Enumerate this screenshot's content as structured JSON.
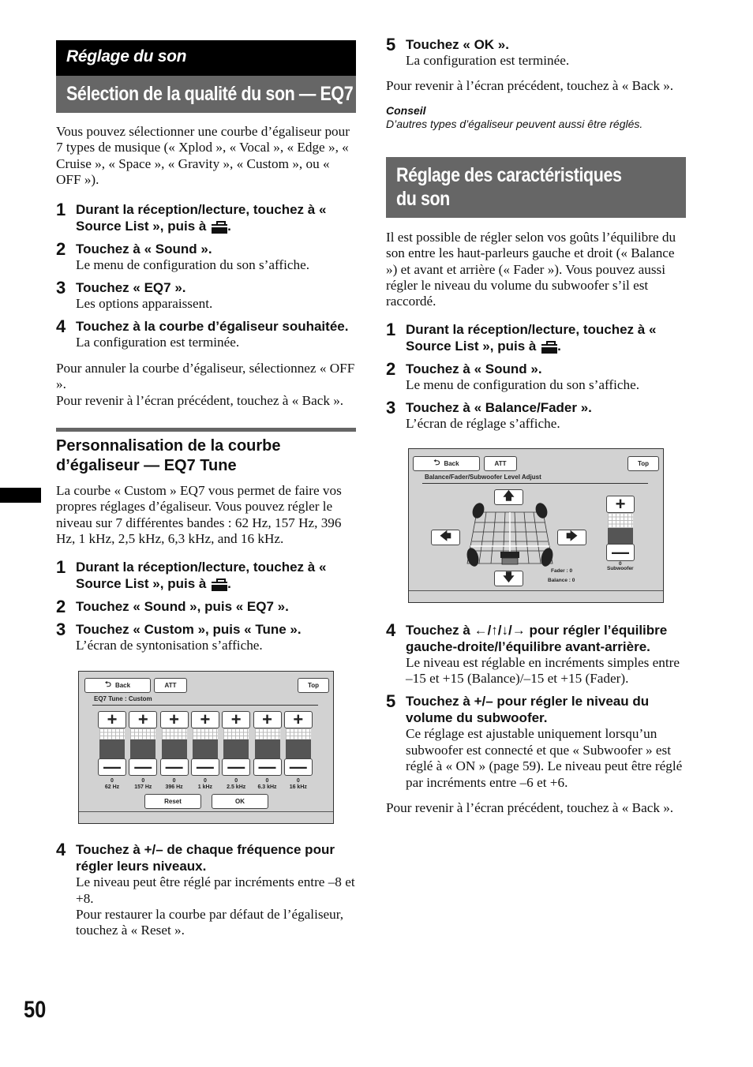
{
  "left": {
    "category": "Réglage du son",
    "title": "Sélection de la qualité du son — EQ7",
    "intro": "Vous pouvez sélectionner une courbe d’égaliseur pour 7 types de musique (« Xplod », « Vocal », « Edge », « Cruise », « Space », « Gravity », « Custom », ou « OFF »).",
    "steps": [
      {
        "num": "1",
        "head": "Durant la réception/lecture, touchez à « Source List », puis à",
        "icon": "toolbox-icon",
        "body": ""
      },
      {
        "num": "2",
        "head": "Touchez à « Sound ».",
        "body": "Le menu de configuration du son s’affiche."
      },
      {
        "num": "3",
        "head": "Touchez « EQ7 ».",
        "body": "Les options apparaissent."
      },
      {
        "num": "4",
        "head": "Touchez à la courbe d’égaliseur souhaitée.",
        "body": "La configuration est terminée."
      }
    ],
    "outro1": "Pour annuler la courbe d’égaliseur, sélectionnez « OFF ».",
    "outro2": "Pour revenir à l’écran précédent, touchez à « Back ».",
    "subsection": {
      "title": "Personnalisation de la courbe d’égaliseur — EQ7 Tune",
      "intro": "La courbe « Custom » EQ7 vous permet de faire vos propres réglages d’égaliseur. Vous pouvez régler le niveau sur 7 différentes bandes : 62 Hz, 157 Hz, 396 Hz, 1 kHz, 2,5 kHz, 6,3 kHz, and 16 kHz.",
      "steps": [
        {
          "num": "1",
          "head": "Durant la réception/lecture, touchez à « Source List », puis à",
          "icon": "toolbox-icon"
        },
        {
          "num": "2",
          "head": "Touchez « Sound », puis « EQ7 »."
        },
        {
          "num": "3",
          "head": "Touchez « Custom », puis « Tune ».",
          "body": "L’écran de syntonisation s’affiche."
        }
      ],
      "step4": {
        "num": "4",
        "head": "Touchez à +/– de chaque fréquence pour régler leurs niveaux.",
        "body1": "Le niveau peut être réglé par incréments entre –8 et +8.",
        "body2": "Pour restaurer la courbe par défaut de l’égaliseur, touchez à « Reset »."
      }
    },
    "eq_screen": {
      "back": "Back",
      "att": "ATT",
      "top": "Top",
      "title": "EQ7 Tune : Custom",
      "bands": [
        {
          "freq": "62 Hz",
          "value": "0"
        },
        {
          "freq": "157 Hz",
          "value": "0"
        },
        {
          "freq": "396 Hz",
          "value": "0"
        },
        {
          "freq": "1 kHz",
          "value": "0"
        },
        {
          "freq": "2.5 kHz",
          "value": "0"
        },
        {
          "freq": "6.3 kHz",
          "value": "0"
        },
        {
          "freq": "16 kHz",
          "value": "0"
        }
      ],
      "plus": "+",
      "minus": "—",
      "reset": "Reset",
      "ok": "OK"
    }
  },
  "right": {
    "step5": {
      "num": "5",
      "head": "Touchez « OK ».",
      "body": "La configuration est terminée."
    },
    "back_text": "Pour revenir à l’écran précédent, touchez à « Back ».",
    "tip_label": "Conseil",
    "tip_text": "D’autres types d’égaliseur peuvent aussi être réglés.",
    "title": "Réglage des caractéristiques du son",
    "title_line1": "Réglage des caractéristiques",
    "title_line2": "du son",
    "intro": "Il est possible de régler selon vos goûts l’équilibre du son entre les haut-parleurs gauche et droit (« Balance ») et avant et arrière (« Fader »). Vous pouvez aussi régler le niveau du volume du subwoofer s’il est raccordé.",
    "steps": [
      {
        "num": "1",
        "head": "Durant la réception/lecture, touchez à « Source List », puis à",
        "icon": "toolbox-icon"
      },
      {
        "num": "2",
        "head": "Touchez à « Sound ».",
        "body": "Le menu de configuration du son s’affiche."
      },
      {
        "num": "3",
        "head": "Touchez à « Balance/Fader ».",
        "body": "L’écran de réglage s’affiche."
      }
    ],
    "balance_screen": {
      "back": "Back",
      "att": "ATT",
      "top": "Top",
      "title": "Balance/Fader/Subwoofer Level Adjust",
      "fader": "Fader : 0",
      "balance": "Balance : 0",
      "sub_value": "0",
      "sub_label": "Subwoofer",
      "up": "🡅",
      "down": "🡇",
      "left": "🡄",
      "right": "🡆"
    },
    "step4": {
      "num": "4",
      "head": "Touchez à ←/↑/↓/→ pour régler l’équilibre gauche-droite/l’équilibre avant-arrière.",
      "body": "Le niveau est réglable en incréments simples entre –15 et +15 (Balance)/–15 et +15 (Fader)."
    },
    "step5b": {
      "num": "5",
      "head": "Touchez à +/– pour régler le niveau du volume du subwoofer.",
      "body": "Ce réglage est ajustable uniquement lorsqu’un subwoofer est connecté et que « Subwoofer » est réglé à « ON » (page 59). Le niveau peut être réglé par incréments entre –6 et +6."
    },
    "back_text2": "Pour revenir à l’écran précédent, touchez à « Back »."
  },
  "page_number": "50"
}
